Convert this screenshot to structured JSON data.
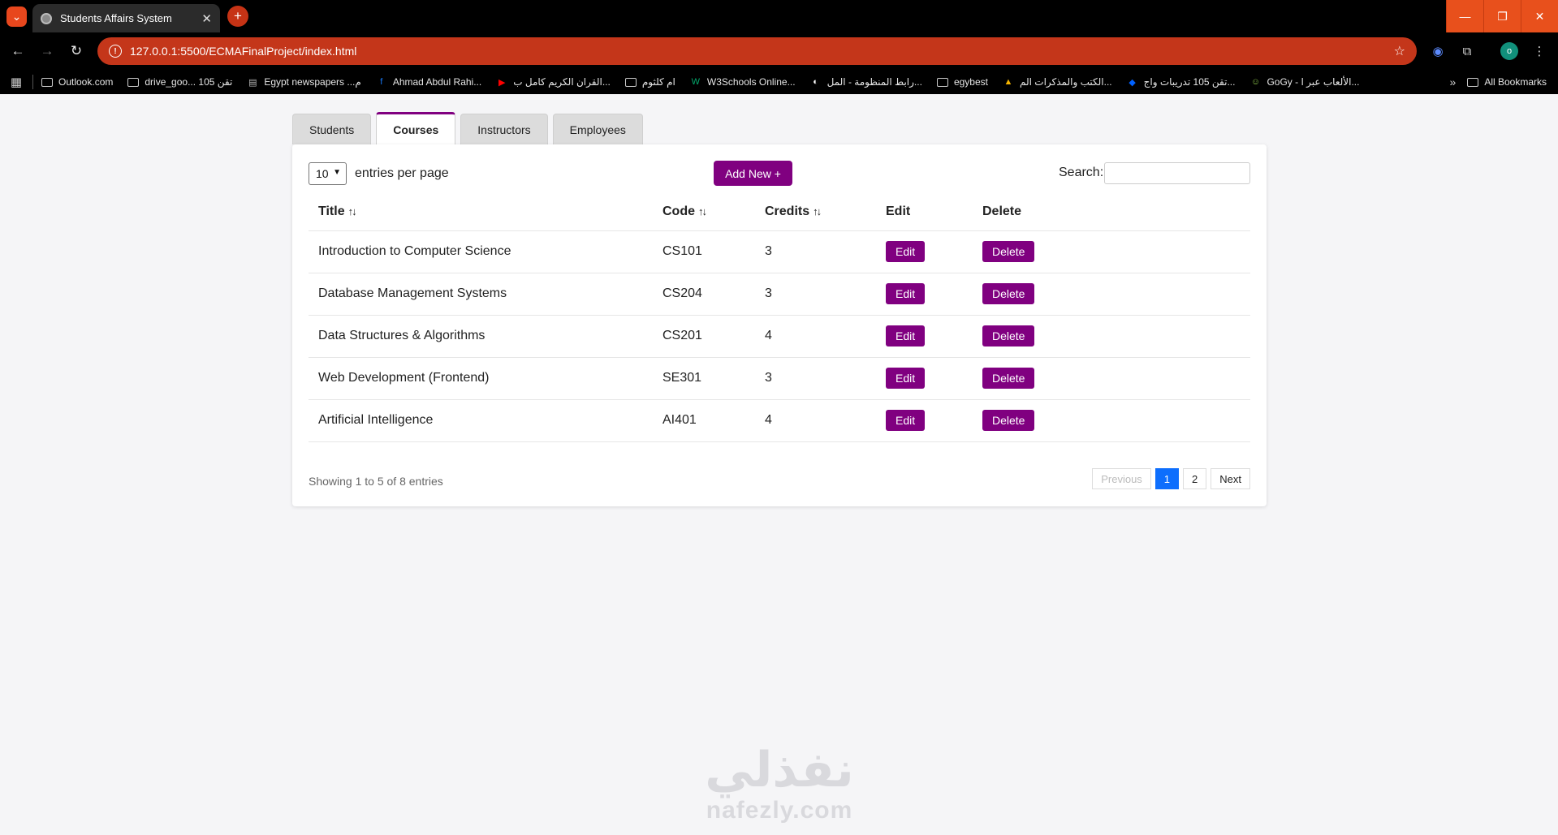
{
  "browser": {
    "tab_title": "Students Affairs System",
    "url": "127.0.0.1:5500/ECMAFinalProject/index.html",
    "bookmarks": [
      {
        "label": "Outlook.com",
        "icon": "folder-icon"
      },
      {
        "label": "drive_goo... تقن 105",
        "icon": "folder-icon"
      },
      {
        "label": "Egypt newspapers ...م",
        "icon": "newspaper-icon"
      },
      {
        "label": "Ahmad Abdul Rahi...",
        "icon": "facebook-icon"
      },
      {
        "label": "القران الكريم كامل ب...",
        "icon": "youtube-icon"
      },
      {
        "label": "ام كلثوم",
        "icon": "folder-icon"
      },
      {
        "label": "W3Schools Online...",
        "icon": "w3schools-icon"
      },
      {
        "label": "رابط المنظومة - المل...",
        "icon": "globe-icon"
      },
      {
        "label": "egybest",
        "icon": "folder-icon"
      },
      {
        "label": "الكتب والمذكرات الم...",
        "icon": "drive-icon"
      },
      {
        "label": "تقن 105 تدريبات واج...",
        "icon": "dropbox-icon"
      },
      {
        "label": "GoGy - الألعاب عبر ا...",
        "icon": "game-icon"
      }
    ],
    "all_bookmarks": "All Bookmarks",
    "profile_initial": "o"
  },
  "nav_tabs": [
    {
      "label": "Students",
      "active": false
    },
    {
      "label": "Courses",
      "active": true
    },
    {
      "label": "Instructors",
      "active": false
    },
    {
      "label": "Employees",
      "active": false
    }
  ],
  "controls": {
    "entries_value": "10",
    "entries_label": "entries per page",
    "add_new_label": "Add New +",
    "search_label": "Search:",
    "search_value": ""
  },
  "table": {
    "headers": [
      "Title",
      "Code",
      "Credits",
      "Edit",
      "Delete"
    ],
    "rows": [
      {
        "title": "Introduction to Computer Science",
        "code": "CS101",
        "credits": "3"
      },
      {
        "title": "Database Management Systems",
        "code": "CS204",
        "credits": "3"
      },
      {
        "title": "Data Structures & Algorithms",
        "code": "CS201",
        "credits": "4"
      },
      {
        "title": "Web Development (Frontend)",
        "code": "SE301",
        "credits": "3"
      },
      {
        "title": "Artificial Intelligence",
        "code": "AI401",
        "credits": "4"
      }
    ],
    "edit_label": "Edit",
    "delete_label": "Delete"
  },
  "footer": {
    "showing": "Showing 1 to 5 of 8 entries",
    "previous": "Previous",
    "pages": [
      "1",
      "2"
    ],
    "next": "Next"
  },
  "watermark": {
    "arabic": "نفذلي",
    "latin": "nafezly.com"
  },
  "colors": {
    "accent": "#800080",
    "pager_active": "#0d6efd",
    "address_bar": "#c4361a"
  }
}
